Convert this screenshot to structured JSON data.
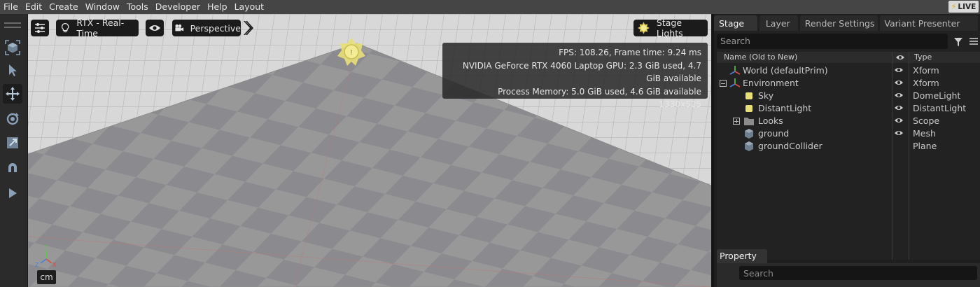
{
  "menu": [
    "File",
    "Edit",
    "Create",
    "Window",
    "Tools",
    "Developer",
    "Help",
    "Layout"
  ],
  "live_label": "LIVE",
  "viewport": {
    "renderer_label": "RTX - Real-Time",
    "camera_label": "Perspective",
    "lights_label": "Stage Lights",
    "stats": {
      "fps": "FPS: 108.26, Frame time: 9.24 ms",
      "gpu": "NVIDIA GeForce RTX 4060 Laptop GPU: 2.3 GiB used, 4.7 GiB available",
      "memory": "Process Memory: 5.0 GiB used, 4.6 GiB available",
      "resolution": "1330x525"
    },
    "axis_labels": {
      "y": "Y",
      "z": "Z",
      "x": "X"
    },
    "unit": "cm"
  },
  "right_panel": {
    "tabs": [
      "Stage",
      "Layer",
      "Render Settings",
      "Variant Presenter"
    ],
    "active_tab": "Stage",
    "search_placeholder": "Search",
    "columns": {
      "name": "Name (Old to New)",
      "type": "Type"
    },
    "tree": [
      {
        "name": "World (defaultPrim)",
        "type": "Xform",
        "icon": "xform-icon",
        "indent": 0,
        "expander": ""
      },
      {
        "name": "Environment",
        "type": "Xform",
        "icon": "xform-icon",
        "indent": 0,
        "expander": "collapse"
      },
      {
        "name": "Sky",
        "type": "DomeLight",
        "icon": "light-icon",
        "indent": 1,
        "expander": ""
      },
      {
        "name": "DistantLight",
        "type": "DistantLight",
        "icon": "light-icon",
        "indent": 1,
        "expander": ""
      },
      {
        "name": "Looks",
        "type": "Scope",
        "icon": "folder-icon",
        "indent": 1,
        "expander": "expand"
      },
      {
        "name": "ground",
        "type": "Mesh",
        "icon": "mesh-icon",
        "indent": 1,
        "expander": ""
      },
      {
        "name": "groundCollider",
        "type": "Plane",
        "icon": "mesh-icon",
        "indent": 1,
        "expander": ""
      }
    ],
    "property_tab": "Property",
    "property_search_placeholder": "Search"
  },
  "colors": {
    "accent_live": "#e0a800",
    "light_icon": "#e8df7a",
    "axis_x": "#d94a4a",
    "axis_y": "#5ec44f",
    "axis_z": "#4a7fd9"
  }
}
